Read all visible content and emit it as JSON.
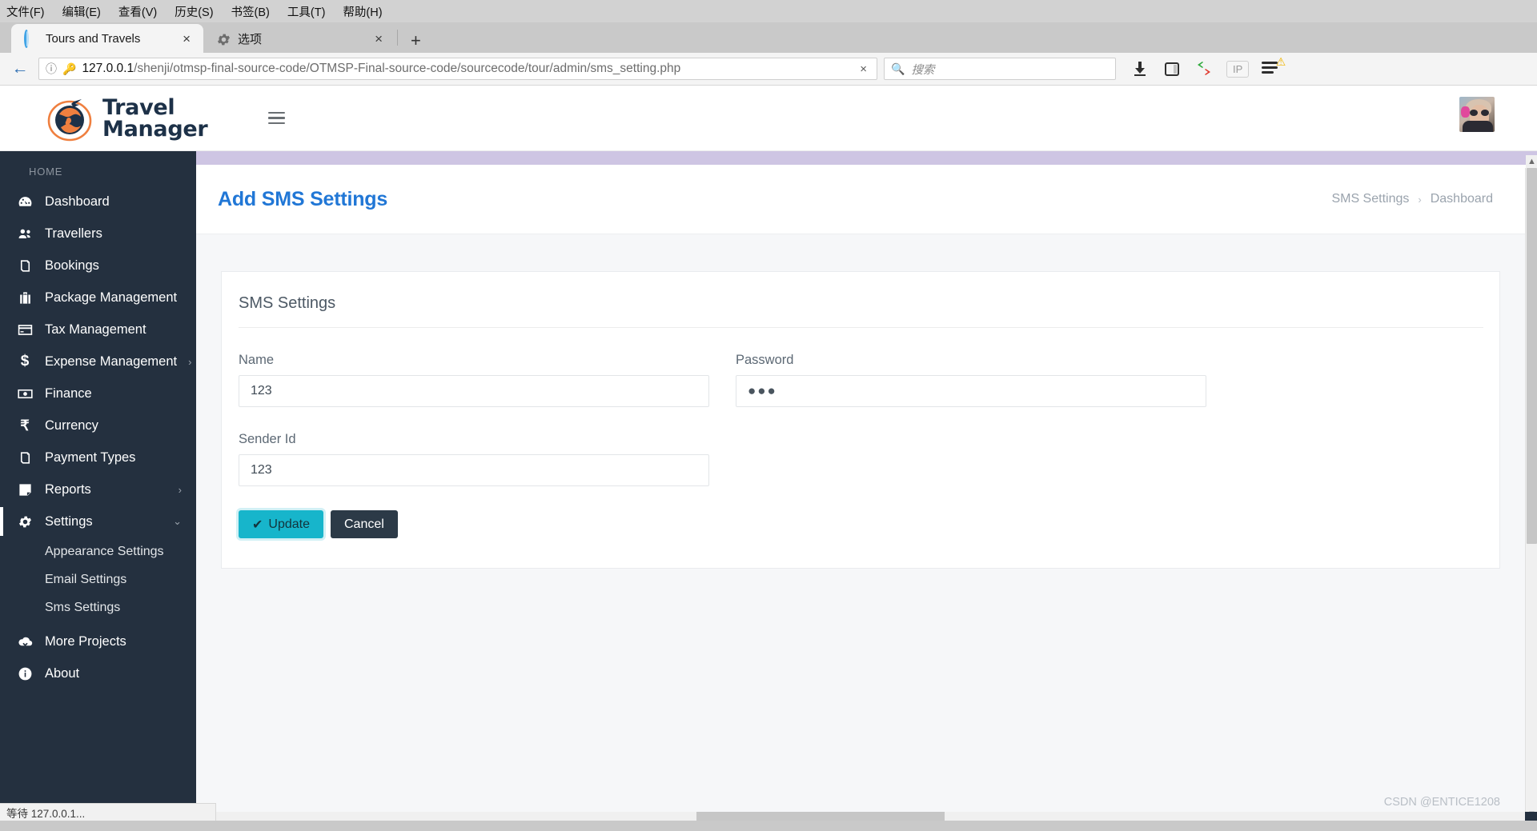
{
  "browser": {
    "menus": [
      "文件(F)",
      "编辑(E)",
      "查看(V)",
      "历史(S)",
      "书签(B)",
      "工具(T)",
      "帮助(H)"
    ],
    "tabs": [
      {
        "title": "Tours and Travels",
        "favicon": "loading-circle-icon",
        "close": "×"
      },
      {
        "title": "选项",
        "favicon": "gear-icon",
        "close": "×"
      }
    ],
    "new_tab": "+",
    "url": "127.0.0.1",
    "url_path": "/shenji/otmsp-final-source-code/OTMSP-Final-source-code/sourcecode/tour/admin/sms_setting.php",
    "url_clear": "×",
    "search_placeholder": "搜索",
    "ip_badge": "IP",
    "status_text": "等待 127.0.0.1...",
    "watermark": "CSDN @ENTICE1208"
  },
  "header": {
    "logo_line1": "Travel",
    "logo_line2": "Manager",
    "menu_toggle": "hamburger-icon",
    "avatar": "user-avatar"
  },
  "sidebar": {
    "section_label": "HOME",
    "items": [
      {
        "label": "Dashboard",
        "icon": "tachometer-icon",
        "chevron": "",
        "active": false
      },
      {
        "label": "Travellers",
        "icon": "users-icon",
        "chevron": "",
        "active": false
      },
      {
        "label": "Bookings",
        "icon": "book-icon",
        "chevron": "",
        "active": false
      },
      {
        "label": "Package Management",
        "icon": "suitcase-icon",
        "chevron": "",
        "active": false
      },
      {
        "label": "Tax Management",
        "icon": "credit-card-icon",
        "chevron": "",
        "active": false
      },
      {
        "label": "Expense Management",
        "icon": "dollar-sign-icon",
        "chevron": "›",
        "active": false
      },
      {
        "label": "Finance",
        "icon": "money-bill-icon",
        "chevron": "",
        "active": false
      },
      {
        "label": "Currency",
        "icon": "rupee-sign-icon",
        "chevron": "",
        "active": false
      },
      {
        "label": "Payment Types",
        "icon": "book-icon",
        "chevron": "",
        "active": false
      },
      {
        "label": "Reports",
        "icon": "sticky-note-icon",
        "chevron": "›",
        "active": false
      },
      {
        "label": "Settings",
        "icon": "gear-icon",
        "chevron": "⌄",
        "active": true
      }
    ],
    "sub_items": [
      "Appearance Settings",
      "Email Settings",
      "Sms Settings"
    ],
    "bottom_items": [
      {
        "label": "More Projects",
        "icon": "cloud-download-icon"
      },
      {
        "label": "About",
        "icon": "info-circle-icon"
      }
    ]
  },
  "page": {
    "title": "Add SMS Settings",
    "breadcrumb": [
      "SMS Settings",
      "Dashboard"
    ],
    "breadcrumb_sep": "›"
  },
  "form": {
    "card_title": "SMS Settings",
    "fields": [
      {
        "label": "Name",
        "value": "123",
        "type": "text"
      },
      {
        "label": "Password",
        "value": "●●●",
        "type": "password"
      },
      {
        "label": "Sender Id",
        "value": "123",
        "type": "text"
      }
    ],
    "update_label": "Update",
    "update_icon": "check-icon",
    "cancel_label": "Cancel"
  },
  "colors": {
    "sidebar_bg": "#24303f",
    "accent_strip": "#cec5e3",
    "title_blue": "#2177d6",
    "update_teal": "#17b5cb",
    "cancel_dark": "#2c3a47"
  }
}
